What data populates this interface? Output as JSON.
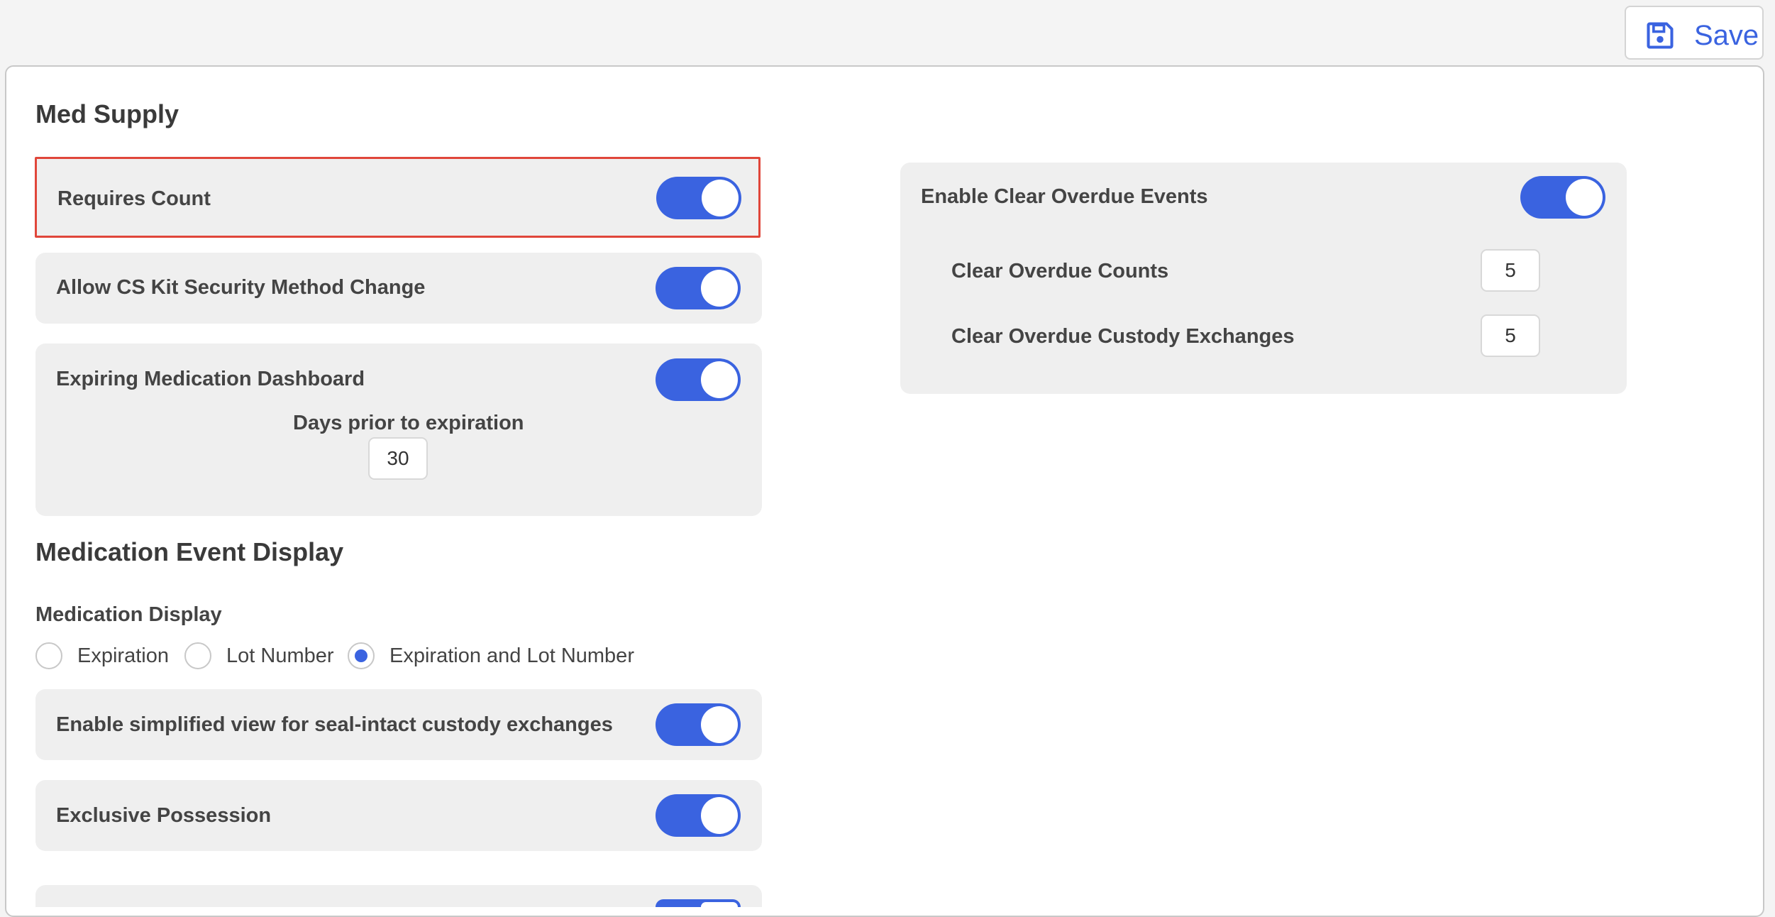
{
  "toolbar": {
    "save_label": "Save",
    "save_icon": "floppy-disk-icon",
    "accent_color": "#3a63e0"
  },
  "med_supply": {
    "title": "Med Supply",
    "requires_count": {
      "label": "Requires Count",
      "enabled": true
    },
    "cs_kit": {
      "label": "Allow CS Kit Security Method Change",
      "enabled": true
    },
    "expiring_dashboard": {
      "label": "Expiring Medication Dashboard",
      "enabled": true,
      "days_label": "Days prior to expiration",
      "days_value": "30"
    },
    "clear_overdue": {
      "label": "Enable Clear Overdue Events",
      "enabled": true,
      "counts_label": "Clear Overdue Counts",
      "counts_value": "5",
      "custody_label": "Clear Overdue Custody Exchanges",
      "custody_value": "5"
    }
  },
  "event_display": {
    "title": "Medication Event Display",
    "medication_display_label": "Medication Display",
    "options": [
      {
        "label": "Expiration",
        "checked": false
      },
      {
        "label": "Lot Number",
        "checked": false
      },
      {
        "label": "Expiration and Lot Number",
        "checked": true
      }
    ],
    "simplified_view": {
      "label": "Enable simplified view for seal-intact custody exchanges",
      "enabled": true
    },
    "exclusive_possession": {
      "label": "Exclusive Possession",
      "enabled": true
    },
    "partial_item": {
      "enabled": true
    }
  },
  "highlight_color": "#e0463a"
}
